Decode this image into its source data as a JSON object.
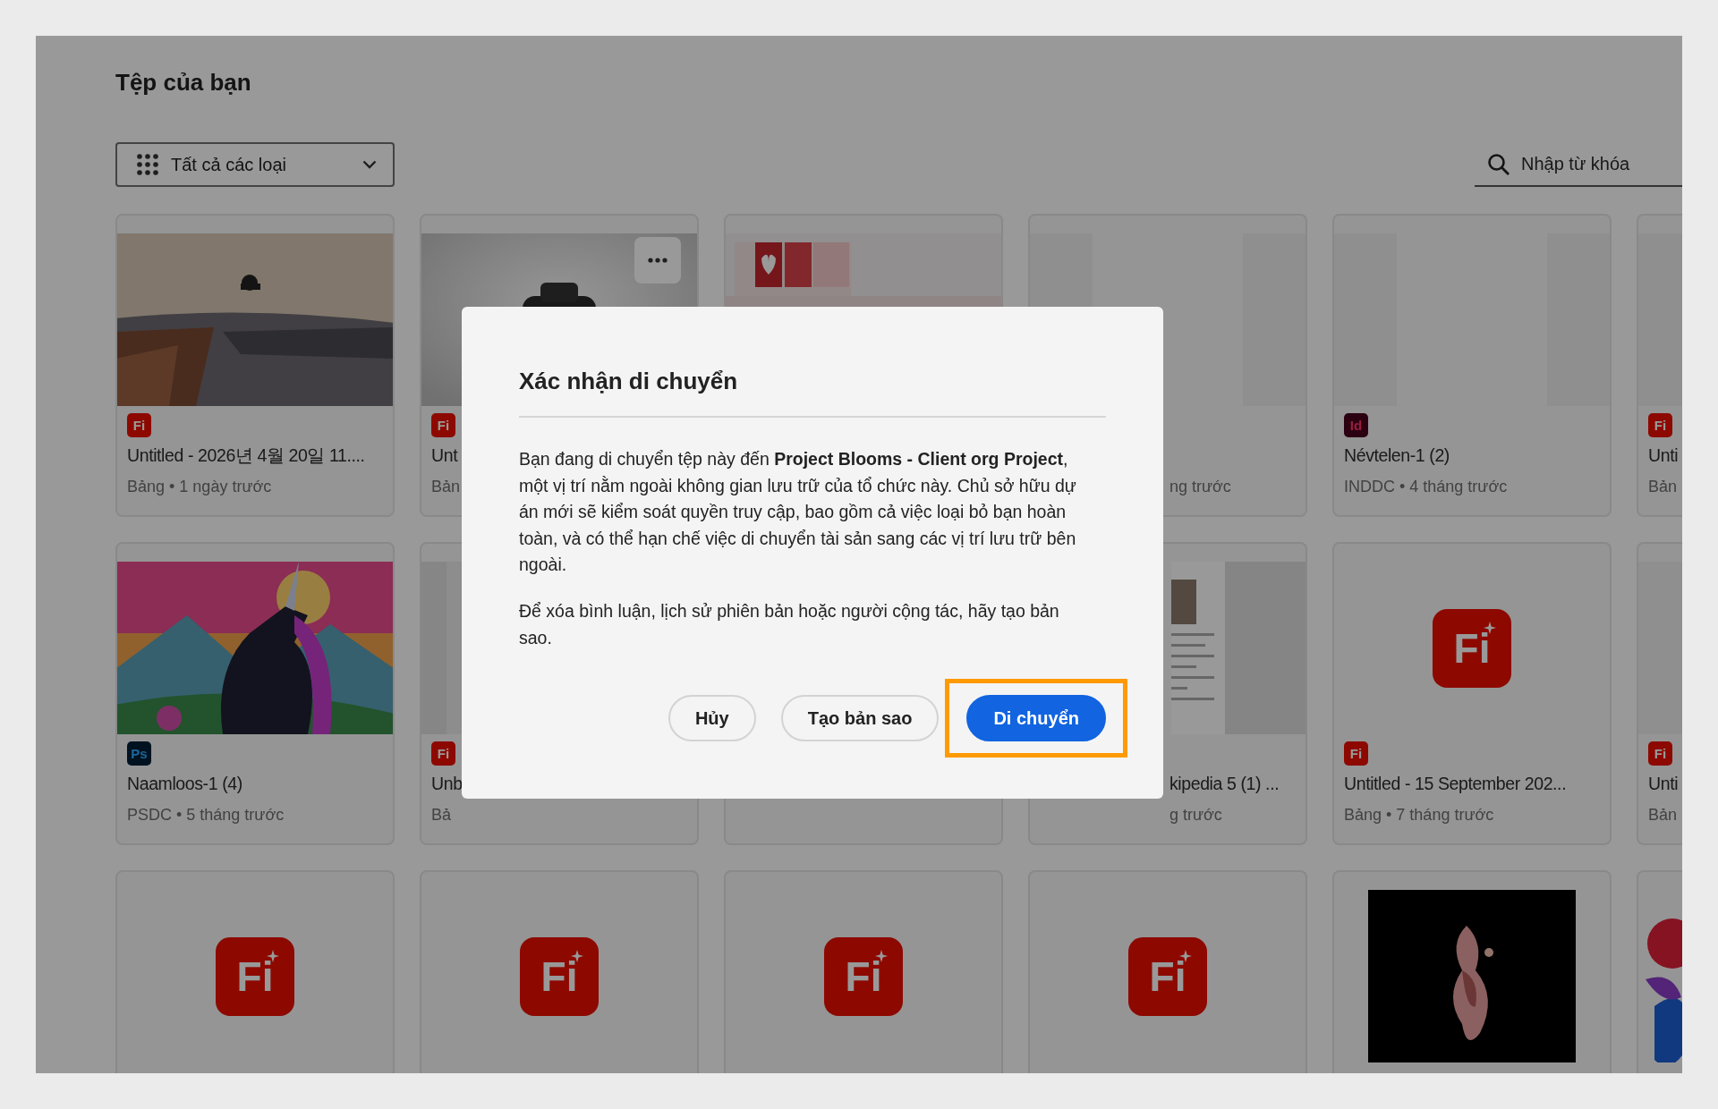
{
  "page": {
    "title": "Tệp của bạn"
  },
  "filter": {
    "label": "Tất cả các loại"
  },
  "search": {
    "placeholder": "Nhập từ khóa"
  },
  "cards": [
    {
      "kind": "picture",
      "badge": {
        "kind": "fi",
        "text": "Fi"
      },
      "title": "Untitled - 2026년 4월 20일 11....",
      "subtitle": "Bảng • 1 ngày trước"
    },
    {
      "kind": "picture",
      "more_button": true,
      "badge": {
        "kind": "fi",
        "text": "Fi"
      },
      "title": "Unt",
      "subtitle": "Bản"
    },
    {
      "kind": "picture"
    },
    {
      "kind": "blank",
      "covered_left": true,
      "subtitle": "ng trước"
    },
    {
      "kind": "blank",
      "badge": {
        "kind": "id",
        "text": "Id"
      },
      "title": "Névtelen-1 (2)",
      "subtitle": "INDDC • 4 tháng trước"
    },
    {
      "kind": "blank",
      "badge": {
        "kind": "fi",
        "text": "Fi"
      },
      "title": "Unti",
      "subtitle": "Bản"
    },
    {
      "kind": "picture",
      "badge": {
        "kind": "ps",
        "text": "Ps"
      },
      "title": "Naamloos-1 (4)",
      "subtitle": "PSDC • 5 tháng trước"
    },
    {
      "kind": "picture",
      "badge": {
        "kind": "fi",
        "text": "Fi"
      },
      "title": "Unb",
      "subtitle": "Bả"
    },
    {
      "kind": "none"
    },
    {
      "kind": "picture",
      "covered_left": true,
      "title": "kipedia 5 (1) ...",
      "subtitle": "g trước"
    },
    {
      "kind": "logo",
      "logo": "Fi",
      "badge": {
        "kind": "fi",
        "text": "Fi"
      },
      "title": "Untitled - 15 September 202...",
      "subtitle": "Bảng • 7 tháng trước"
    },
    {
      "kind": "blank",
      "badge": {
        "kind": "fi",
        "text": "Fi"
      },
      "title": "Unti",
      "subtitle": "Bản"
    },
    {
      "kind": "logo",
      "logo": "Fi"
    },
    {
      "kind": "logo",
      "logo": "Fi"
    },
    {
      "kind": "logo",
      "logo": "Fi"
    },
    {
      "kind": "logo",
      "logo": "Fi"
    },
    {
      "kind": "picture"
    },
    {
      "kind": "picture"
    }
  ],
  "dialog": {
    "title": "Xác nhận di chuyển",
    "paragraphs": [
      "Bạn đang di chuyển tệp này đến **Project Blooms - Client org Project**, một vị trí nằm ngoài không gian lưu trữ của tổ chức này. Chủ sở hữu dự án mới sẽ kiểm soát quyền truy cập, bao gồm cả việc loại bỏ bạn hoàn toàn, và có thể hạn chế việc di chuyển tài sản sang các vị trí lưu trữ bên ngoài.",
      "Để xóa bình luận, lịch sử phiên bản hoặc người cộng tác, hãy tạo bản sao."
    ],
    "buttons": [
      {
        "label": "Hủy",
        "kind": "secondary",
        "highlighted": false
      },
      {
        "label": "Tạo bản sao",
        "kind": "secondary",
        "highlighted": false
      },
      {
        "label": "Di chuyển",
        "kind": "primary",
        "highlighted": true
      }
    ]
  }
}
